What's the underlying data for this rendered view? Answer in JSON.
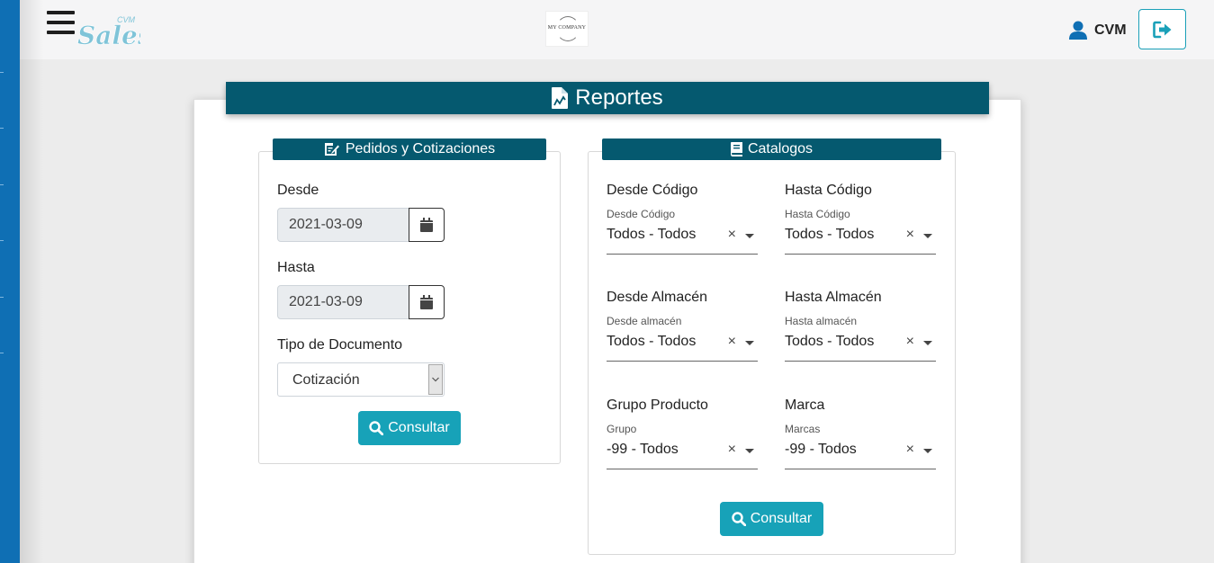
{
  "header": {
    "brand_small": "CVM",
    "brand_main": "Sales",
    "company_logo_text": "MY COMPANY",
    "user_name": "CVM"
  },
  "page": {
    "title": "Reportes"
  },
  "pedidos": {
    "title": "Pedidos y Cotizaciones",
    "desde_label": "Desde",
    "desde_value": "2021-03-09",
    "hasta_label": "Hasta",
    "hasta_value": "2021-03-09",
    "tipo_label": "Tipo de Documento",
    "tipo_value": "Cotización",
    "consultar": "Consultar"
  },
  "catalogos": {
    "title": "Catalogos",
    "fields": [
      {
        "label": "Desde Código",
        "small": "Desde Código",
        "value": "Todos - Todos"
      },
      {
        "label": "Hasta Código",
        "small": "Hasta Código",
        "value": "Todos - Todos"
      },
      {
        "label": "Desde Almacén",
        "small": "Desde almacén",
        "value": "Todos - Todos"
      },
      {
        "label": "Hasta Almacén",
        "small": "Hasta almacén",
        "value": "Todos - Todos"
      },
      {
        "label": "Grupo Producto",
        "small": "Grupo",
        "value": "-99 - Todos"
      },
      {
        "label": "Marca",
        "small": "Marcas",
        "value": "-99 - Todos"
      }
    ],
    "clear_symbol": "×",
    "consultar": "Consultar"
  },
  "icons": {
    "menu": "hamburger-menu-icon",
    "user": "user-icon",
    "logout": "sign-out-icon",
    "report": "file-chart-icon",
    "edit": "edit-document-icon",
    "book": "book-icon",
    "calendar": "calendar-icon",
    "search": "search-icon"
  },
  "colors": {
    "sidebar": "#0f6fb4",
    "header_bar": "#05596f",
    "button": "#17a2b8",
    "logout_border": "#1aa0b8",
    "brand": "#7fc4d8"
  }
}
